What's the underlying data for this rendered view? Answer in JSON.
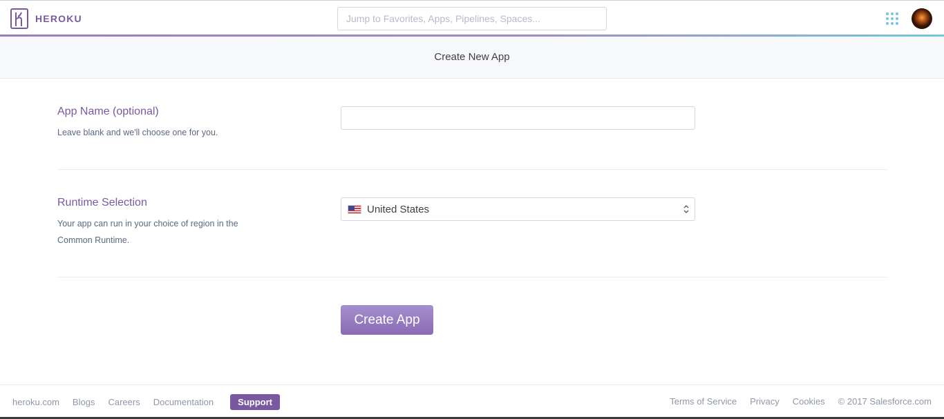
{
  "brand": {
    "name": "HEROKU",
    "accent": "#79589f",
    "secondary_accent": "#79c4dc"
  },
  "topnav": {
    "search_placeholder": "Jump to Favorites, Apps, Pipelines, Spaces...",
    "apps_icon": "apps-grid-icon",
    "avatar_icon": "user-avatar"
  },
  "header": {
    "title": "Create New App"
  },
  "app_name": {
    "label": "App Name (optional)",
    "description": "Leave blank and we'll choose one for you.",
    "value": ""
  },
  "runtime": {
    "label": "Runtime Selection",
    "description": "Your app can run in your choice of region in the Common Runtime.",
    "selected_region": "United States",
    "selected_flag_icon": "us-flag-icon"
  },
  "actions": {
    "create_label": "Create App"
  },
  "footer": {
    "left_links": [
      "heroku.com",
      "Blogs",
      "Careers",
      "Documentation"
    ],
    "support_label": "Support",
    "right_links": [
      "Terms of Service",
      "Privacy",
      "Cookies"
    ],
    "copyright": "© 2017 Salesforce.com"
  }
}
